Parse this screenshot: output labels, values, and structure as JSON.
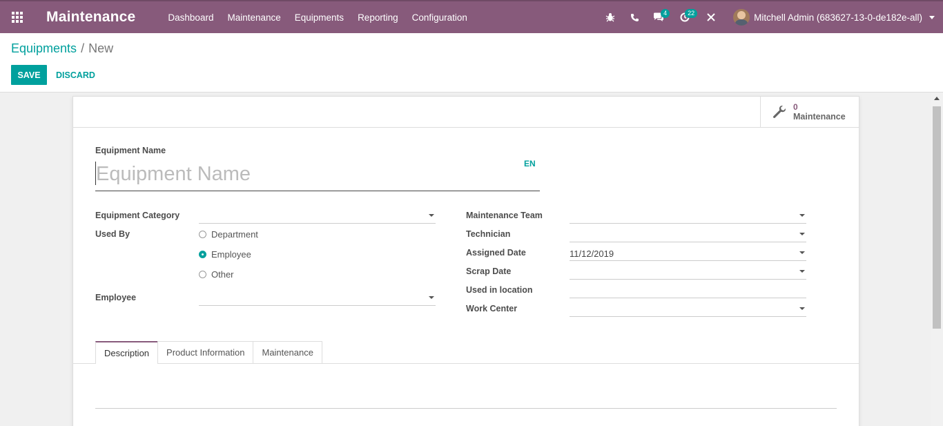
{
  "navbar": {
    "app_title": "Maintenance",
    "menu": [
      "Dashboard",
      "Maintenance",
      "Equipments",
      "Reporting",
      "Configuration"
    ],
    "messages_count": "4",
    "activities_count": "22",
    "user_name": "Mitchell Admin (683627-13-0-de182e-all)",
    "color": "#875a7b"
  },
  "breadcrumb": {
    "parent": "Equipments",
    "separator": "/",
    "current": "New"
  },
  "actions": {
    "save": "SAVE",
    "discard": "DISCARD",
    "accent": "#00a09d"
  },
  "stat_button": {
    "value": "0",
    "label": "Maintenance",
    "icon": "wrench-icon"
  },
  "form": {
    "name_label": "Equipment Name",
    "name_placeholder": "Equipment Name",
    "lang": "EN",
    "left": {
      "category_label": "Equipment Category",
      "category_value": "",
      "used_by_label": "Used By",
      "used_by_options": [
        "Department",
        "Employee",
        "Other"
      ],
      "used_by_selected": "Employee",
      "employee_label": "Employee",
      "employee_value": ""
    },
    "right": {
      "team_label": "Maintenance Team",
      "team_value": "",
      "technician_label": "Technician",
      "technician_value": "",
      "assigned_date_label": "Assigned Date",
      "assigned_date_value": "11/12/2019",
      "scrap_date_label": "Scrap Date",
      "scrap_date_value": "",
      "location_label": "Used in location",
      "location_value": "",
      "work_center_label": "Work Center",
      "work_center_value": ""
    }
  },
  "tabs": [
    "Description",
    "Product Information",
    "Maintenance"
  ],
  "active_tab": "Description"
}
